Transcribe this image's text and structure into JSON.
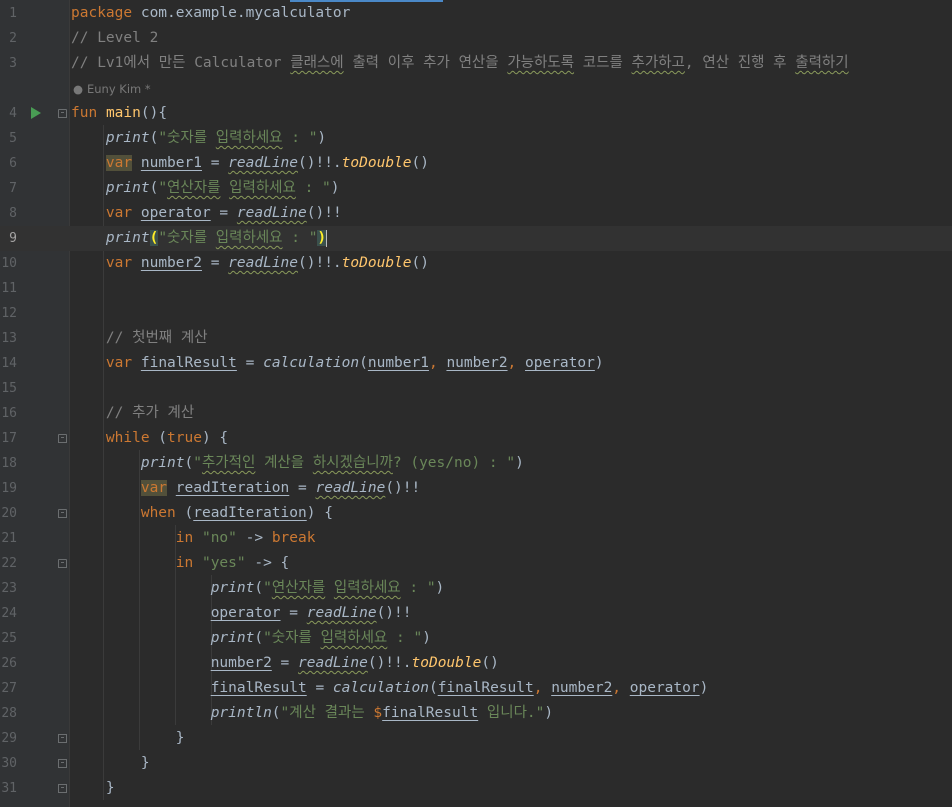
{
  "editor": {
    "current_line": 9,
    "author_hint": "Euny Kim *",
    "line_numbers": [
      "1",
      "2",
      "3",
      "4",
      "5",
      "6",
      "7",
      "8",
      "9",
      "10",
      "11",
      "12",
      "13",
      "14",
      "15",
      "16",
      "17",
      "18",
      "19",
      "20",
      "21",
      "22",
      "23",
      "24",
      "25",
      "26",
      "27",
      "28",
      "29",
      "30",
      "31"
    ]
  },
  "colors": {
    "background": "#2b2b2b",
    "gutter": "#313335",
    "keyword": "#cc7832",
    "string": "#6a8759",
    "comment": "#808080",
    "function": "#ffc66d",
    "text": "#a9b7c6",
    "run_icon": "#499c54"
  },
  "code": {
    "l1_kw": "package",
    "l1_rest": " com.example.mycalculator",
    "l2": "// Level 2",
    "l3_a": "// Lv1에서 만든 Calculator ",
    "l3_b": "클래스에",
    "l3_c": " 출력 이후 추가 연산을 ",
    "l3_d": "가능하도록",
    "l3_e": " 코드를 ",
    "l3_f": "추가하고",
    "l3_g": ", 연산 진행 후 ",
    "l3_h": "출력하기",
    "l4_kw": "fun",
    "l4_name": "main",
    "l4_rest": "(){",
    "l5_fn": "print",
    "l5_open": "(",
    "l5_str_a": "\"숫자를 ",
    "l5_str_b": "입력하세요",
    "l5_str_c": " : \"",
    "l5_close": ")",
    "l6_kw": "var",
    "l6_var": "number1",
    "l6_eq": " = ",
    "l6_fn": "readLine",
    "l6_mid": "()!!.",
    "l6_ext": "toDouble",
    "l6_end": "()",
    "l7_fn": "print",
    "l7_open": "(",
    "l7_str_a": "\"",
    "l7_str_b": "연산자를",
    "l7_str_c": " ",
    "l7_str_d": "입력하세요",
    "l7_str_e": " : \"",
    "l7_close": ")",
    "l8_kw": "var",
    "l8_var": "operator",
    "l8_eq": " = ",
    "l8_fn": "readLine",
    "l8_end": "()!!",
    "l9_fn": "print",
    "l9_open": "(",
    "l9_str_a": "\"숫자를 ",
    "l9_str_b": "입력하세요",
    "l9_str_c": " : \"",
    "l9_close": ")",
    "l10_kw": "var",
    "l10_var": "number2",
    "l10_eq": " = ",
    "l10_fn": "readLine",
    "l10_mid": "()!!.",
    "l10_ext": "toDouble",
    "l10_end": "()",
    "l13": "// 첫번째 계산",
    "l14_kw": "var",
    "l14_var": "finalResult",
    "l14_eq": " = ",
    "l14_fn": "calculation",
    "l14_open": "(",
    "l14_a1": "number1",
    "l14_c1": ", ",
    "l14_a2": "number2",
    "l14_c2": ", ",
    "l14_a3": "operator",
    "l14_close": ")",
    "l16": "// 추가 계산",
    "l17_kw": "while",
    "l17_open": " (",
    "l17_true": "true",
    "l17_close": ") {",
    "l18_fn": "print",
    "l18_open": "(",
    "l18_str_a": "\"",
    "l18_str_b": "추가적인",
    "l18_str_c": " 계산을 ",
    "l18_str_d": "하시겠습니까",
    "l18_str_e": "? (yes/no) : \"",
    "l18_close": ")",
    "l19_kw": "var",
    "l19_var": "readIteration",
    "l19_eq": " = ",
    "l19_fn": "readLine",
    "l19_end": "()!!",
    "l20_kw": "when",
    "l20_open": " (",
    "l20_var": "readIteration",
    "l20_close": ") {",
    "l21_kw": "in",
    "l21_str": "\"no\"",
    "l21_arrow": " -> ",
    "l21_kw2": "break",
    "l22_kw": "in",
    "l22_str": "\"yes\"",
    "l22_arrow": " -> {",
    "l23_fn": "print",
    "l23_open": "(",
    "l23_str_a": "\"",
    "l23_str_b": "연산자를",
    "l23_str_c": " ",
    "l23_str_d": "입력하세요",
    "l23_str_e": " : \"",
    "l23_close": ")",
    "l24_var": "operator",
    "l24_eq": " = ",
    "l24_fn": "readLine",
    "l24_end": "()!!",
    "l25_fn": "print",
    "l25_open": "(",
    "l25_str_a": "\"숫자를 ",
    "l25_str_b": "입력하세요",
    "l25_str_c": " : \"",
    "l25_close": ")",
    "l26_var": "number2",
    "l26_eq": " = ",
    "l26_fn": "readLine",
    "l26_mid": "()!!.",
    "l26_ext": "toDouble",
    "l26_end": "()",
    "l27_var": "finalResult",
    "l27_eq": " = ",
    "l27_fn": "calculation",
    "l27_open": "(",
    "l27_a1": "finalResult",
    "l27_c1": ", ",
    "l27_a2": "number2",
    "l27_c2": ", ",
    "l27_a3": "operator",
    "l27_close": ")",
    "l28_fn": "println",
    "l28_open": "(",
    "l28_str_a": "\"계산 결과는 ",
    "l28_dollar": "$",
    "l28_var": "finalResult",
    "l28_str_b": " 입니다.\"",
    "l28_close": ")",
    "l29": "}",
    "l30": "}",
    "l31": "}"
  }
}
